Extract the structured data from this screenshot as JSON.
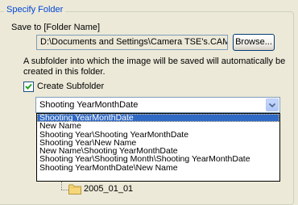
{
  "group": {
    "title": "Specify Folder"
  },
  "save": {
    "label": "Save to [Folder Name]",
    "path": "D:\\Documents and Settings\\Camera TSE's.CAMER",
    "browse_label": "Browse..."
  },
  "description": {
    "line1": "A subfolder into which the image will be saved will automatically be",
    "line2": "created in this folder."
  },
  "subfolder": {
    "checked": true,
    "label": "Create Subfolder"
  },
  "select": {
    "value": "Shooting YearMonthDate",
    "options": [
      "Shooting YearMonthDate",
      "New Name",
      "Shooting Year\\Shooting YearMonthDate",
      "Shooting Year\\New Name",
      "New Name\\Shooting YearMonthDate",
      "Shooting Year\\Shooting Month\\Shooting YearMonthDate",
      "Shooting YearMonthDate\\New Name"
    ]
  },
  "tree": {
    "folder_label": "2005_01_01"
  },
  "colors": {
    "selection": "#316ac5",
    "group_title": "#0046d5",
    "folder": "#f5d77a"
  }
}
